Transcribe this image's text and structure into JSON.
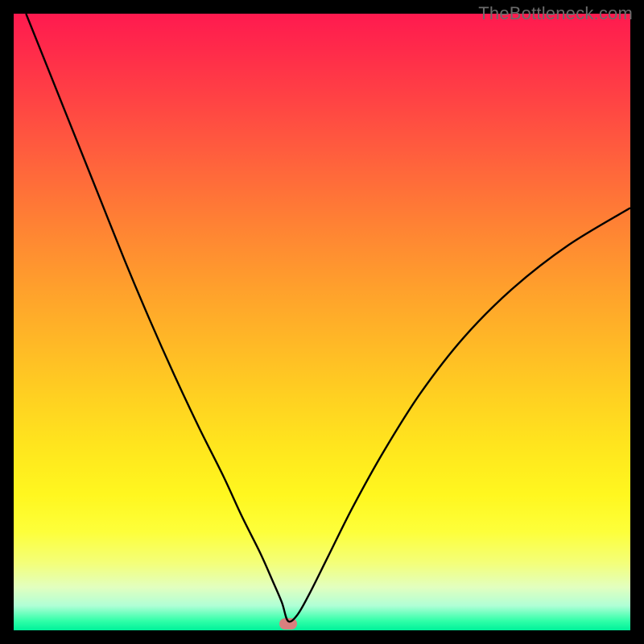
{
  "watermark": "TheBottleneck.com",
  "chart_data": {
    "type": "line",
    "title": "",
    "xlabel": "",
    "ylabel": "",
    "xlim": [
      0,
      100
    ],
    "ylim": [
      0,
      100
    ],
    "grid": false,
    "legend": false,
    "background_gradient": {
      "top": "#ff1a4f",
      "mid": "#ffe51e",
      "bottom": "#00f19a"
    },
    "series": [
      {
        "name": "bottleneck-curve",
        "color": "#000000",
        "x": [
          2,
          6,
          10,
          14,
          18,
          22,
          26,
          30,
          34,
          37,
          40,
          42,
          43.5,
          44.5,
          46,
          48,
          51,
          55,
          60,
          66,
          73,
          81,
          90,
          100
        ],
        "values": [
          100,
          90,
          80,
          70,
          60,
          50.5,
          41.5,
          33,
          25,
          18.5,
          12.5,
          8,
          4.5,
          1.5,
          2.5,
          6,
          12,
          20,
          29,
          38.5,
          47.5,
          55.5,
          62.5,
          68.5
        ]
      }
    ],
    "marker": {
      "name": "optimum-marker",
      "color": "#d97f7e",
      "x": 44.5,
      "y": 1.0
    }
  }
}
